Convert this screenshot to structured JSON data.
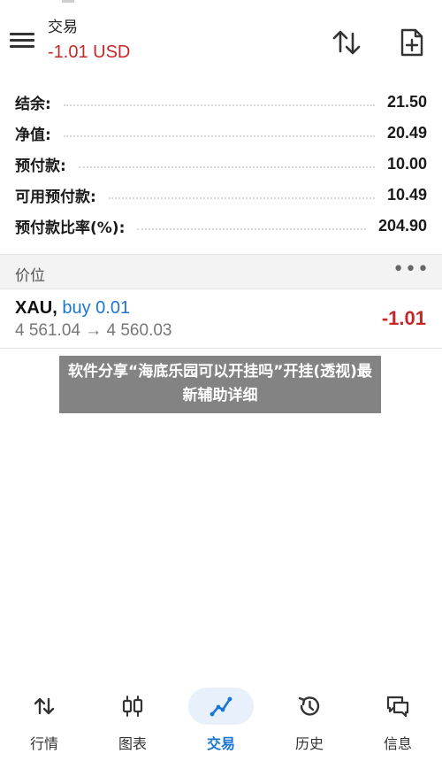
{
  "header": {
    "title": "交易",
    "subtitle": "-1.01 USD",
    "icons": {
      "menu": "hamburger-menu-icon",
      "sort": "sort-arrows-icon",
      "new_order": "new-document-icon"
    }
  },
  "summary": [
    {
      "label": "结余:",
      "value": "21.50"
    },
    {
      "label": "净值:",
      "value": "20.49"
    },
    {
      "label": "预付款:",
      "value": "10.00"
    },
    {
      "label": "可用预付款:",
      "value": "10.49"
    },
    {
      "label": "预付款比率(%):",
      "value": "204.90"
    }
  ],
  "positions_section": {
    "title": "价位",
    "more": "•••"
  },
  "position": {
    "symbol": "XAU,",
    "direction": "buy 0.01",
    "prices": "4 561.04 → 4 560.03",
    "profit": "-1.01"
  },
  "banner": {
    "text": "软件分享“海底乐园可以开挂吗”开挂(透视)最新辅助详细"
  },
  "bottom_nav": [
    {
      "label": "行情",
      "icon": "quotes-arrows-icon",
      "active": false
    },
    {
      "label": "图表",
      "icon": "candlestick-chart-icon",
      "active": false
    },
    {
      "label": "交易",
      "icon": "trade-line-icon",
      "active": true
    },
    {
      "label": "历史",
      "icon": "history-clock-icon",
      "active": false
    },
    {
      "label": "信息",
      "icon": "messages-icon",
      "active": false
    }
  ],
  "colors": {
    "negative": "#c62828",
    "accent": "#1976d2"
  }
}
